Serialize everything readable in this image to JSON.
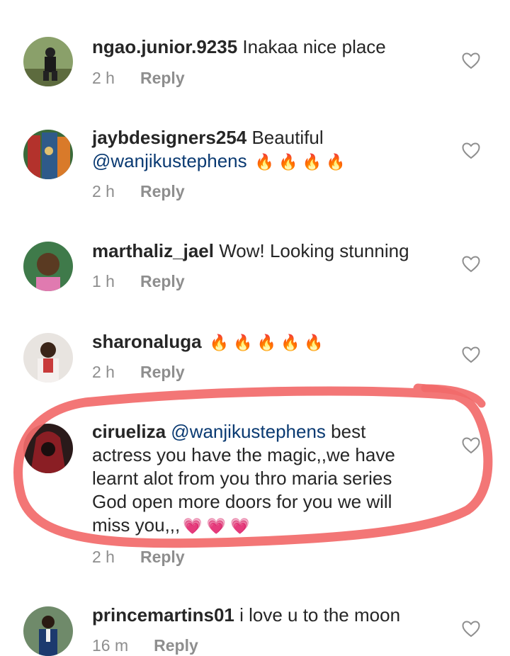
{
  "comments": [
    {
      "username": "ngao.junior.9235",
      "text": "Inakaa nice place",
      "mention": "",
      "emoji": "",
      "time": "2 h",
      "reply": "Reply"
    },
    {
      "username": "jaybdesigners254",
      "text": "Beautiful",
      "mention": "@wanjikustephens",
      "emoji": "🔥🔥🔥🔥",
      "time": "2 h",
      "reply": "Reply"
    },
    {
      "username": "marthaliz_jael",
      "text": "Wow! Looking stunning",
      "mention": "",
      "emoji": "",
      "time": "1 h",
      "reply": "Reply"
    },
    {
      "username": "sharonaluga",
      "text": "",
      "mention": "",
      "emoji": "🔥🔥🔥🔥🔥",
      "time": "2 h",
      "reply": "Reply"
    },
    {
      "username": "cirueliza",
      "mention": "@wanjikustephens",
      "text": "best actress you have the magic,,we have learnt alot from you thro maria series God open more doors for you we will miss you,,,",
      "emoji": "💗💗💗",
      "time": "2 h",
      "reply": "Reply"
    },
    {
      "username": "princemartins01",
      "text": "i love u to the moon",
      "mention": "",
      "emoji": "",
      "time": "16 m",
      "reply": "Reply"
    }
  ],
  "colors": {
    "text": "#262626",
    "meta": "#8e8e8e",
    "mention": "#0a3a72",
    "highlight": "#f26a6a"
  },
  "icons": {
    "like": "heart-outline-icon"
  }
}
